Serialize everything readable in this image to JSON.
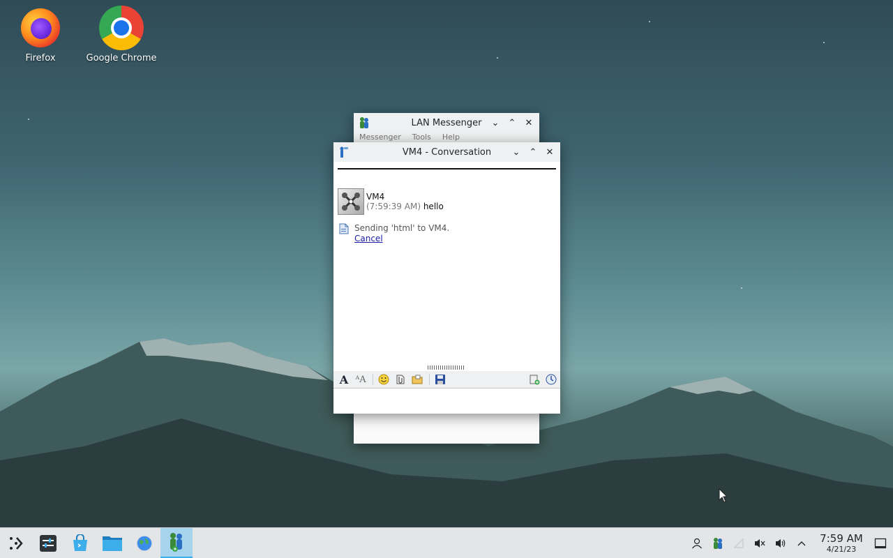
{
  "desktop": {
    "icons": [
      {
        "label": "Firefox",
        "icon": "firefox-icon"
      },
      {
        "label": "Google Chrome",
        "icon": "chrome-icon"
      }
    ]
  },
  "windows": {
    "lan_messenger": {
      "title": "LAN Messenger",
      "menu": [
        "Messenger",
        "Tools",
        "Help"
      ]
    },
    "conversation": {
      "title": "VM4 - Conversation",
      "sender": "VM4",
      "message_time": "(7:59:39 AM)",
      "message_text": "hello",
      "file_status": "Sending 'html' to VM4.",
      "cancel_label": "Cancel"
    }
  },
  "taskbar": {
    "clock_time": "7:59 AM",
    "clock_date": "4/21/23"
  },
  "colors": {
    "taskbar_active": "#a6d4ec",
    "link": "#1a1aa6"
  }
}
